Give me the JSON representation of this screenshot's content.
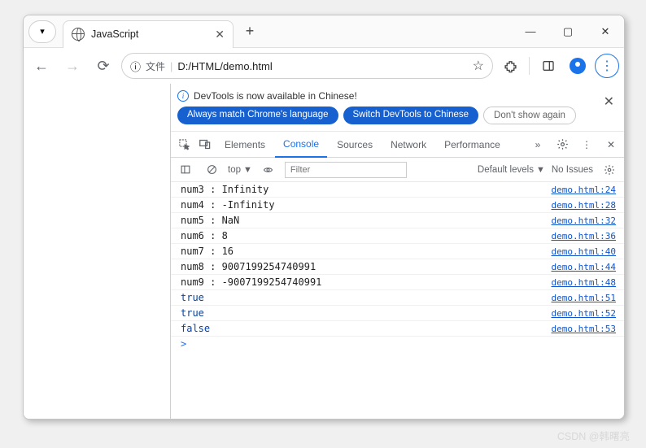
{
  "tab": {
    "title": "JavaScript"
  },
  "address": {
    "prefix_icon": "ⓘ",
    "prefix_text": "文件",
    "url": "D:/HTML/demo.html"
  },
  "devtools": {
    "notice": {
      "text": "DevTools is now available in Chinese!",
      "btn_match": "Always match Chrome's language",
      "btn_switch": "Switch DevTools to Chinese",
      "btn_dont": "Don't show again"
    },
    "tabs": {
      "elements": "Elements",
      "console": "Console",
      "sources": "Sources",
      "network": "Network",
      "performance": "Performance"
    },
    "console_bar": {
      "context": "top",
      "filter_placeholder": "Filter",
      "levels": "Default levels",
      "issues": "No Issues"
    },
    "logs": [
      {
        "label": "num3 : ",
        "value": "Infinity",
        "blue": false,
        "link": "demo.html:24"
      },
      {
        "label": "num4 : ",
        "value": "-Infinity",
        "blue": false,
        "link": "demo.html:28"
      },
      {
        "label": "num5 : ",
        "value": "NaN",
        "blue": false,
        "link": "demo.html:32"
      },
      {
        "label": "num6 : ",
        "value": "8",
        "blue": false,
        "link": "demo.html:36"
      },
      {
        "label": "num7 : ",
        "value": "16",
        "blue": false,
        "link": "demo.html:40"
      },
      {
        "label": "num8 : ",
        "value": "9007199254740991",
        "blue": false,
        "link": "demo.html:44"
      },
      {
        "label": "num9 : ",
        "value": "-9007199254740991",
        "blue": false,
        "link": "demo.html:48"
      },
      {
        "label": "",
        "value": "true",
        "blue": true,
        "link": "demo.html:51"
      },
      {
        "label": "",
        "value": "true",
        "blue": true,
        "link": "demo.html:52"
      },
      {
        "label": "",
        "value": "false",
        "blue": true,
        "link": "demo.html:53"
      }
    ]
  },
  "watermark": "CSDN @韩曙亮"
}
